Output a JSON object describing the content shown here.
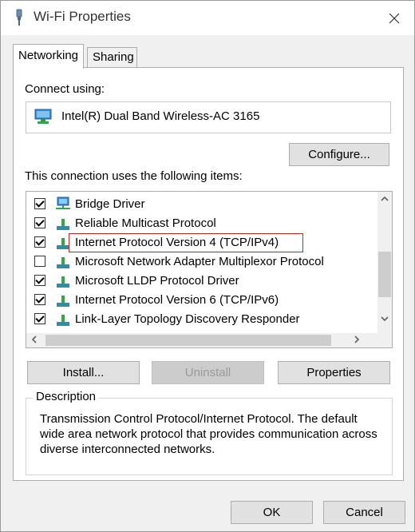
{
  "window": {
    "title": "Wi-Fi Properties",
    "close_label": "✕"
  },
  "tabs": [
    {
      "label": "Networking",
      "active": true
    },
    {
      "label": "Sharing",
      "active": false
    }
  ],
  "connect": {
    "label": "Connect using:",
    "adapter": "Intel(R) Dual Band Wireless-AC 3165",
    "configure_label": "Configure..."
  },
  "items_section": {
    "label": "This connection uses the following items:",
    "items": [
      {
        "label": "Bridge Driver",
        "checked": true,
        "icon": "network-bridge-icon"
      },
      {
        "label": "Reliable Multicast Protocol",
        "checked": true,
        "icon": "protocol-icon"
      },
      {
        "label": "Internet Protocol Version 4 (TCP/IPv4)",
        "checked": true,
        "icon": "protocol-icon"
      },
      {
        "label": "Microsoft Network Adapter Multiplexor Protocol",
        "checked": false,
        "icon": "protocol-icon"
      },
      {
        "label": "Microsoft LLDP Protocol Driver",
        "checked": true,
        "icon": "protocol-icon"
      },
      {
        "label": "Internet Protocol Version 6 (TCP/IPv6)",
        "checked": true,
        "icon": "protocol-icon"
      },
      {
        "label": "Link-Layer Topology Discovery Responder",
        "checked": true,
        "icon": "protocol-icon"
      }
    ]
  },
  "buttons": {
    "install": "Install...",
    "uninstall": "Uninstall",
    "properties": "Properties",
    "ok": "OK",
    "cancel": "Cancel"
  },
  "description": {
    "legend": "Description",
    "text": "Transmission Control Protocol/Internet Protocol. The default wide area network protocol that provides communication across diverse interconnected networks."
  },
  "colors": {
    "highlight_border": "#c0292a",
    "dialog_bg": "#f0f0f0",
    "protocol_green": "#3aa34a",
    "protocol_teal": "#2f8fa0"
  }
}
